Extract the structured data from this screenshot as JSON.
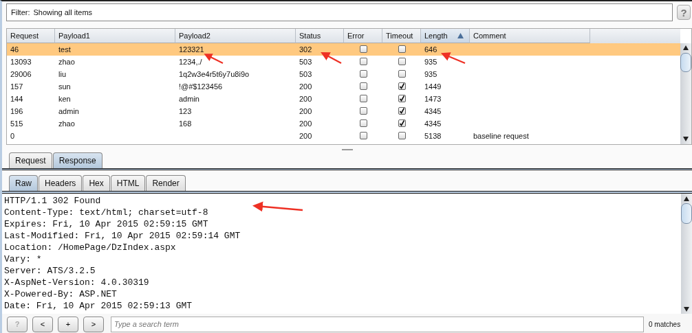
{
  "filter": {
    "label": "Filter:",
    "text": "Showing all items",
    "help": "?"
  },
  "table": {
    "columns": [
      {
        "label": "Request",
        "sorted": false
      },
      {
        "label": "Payload1",
        "sorted": false
      },
      {
        "label": "Payload2",
        "sorted": false
      },
      {
        "label": "Status",
        "sorted": false
      },
      {
        "label": "Error",
        "sorted": false
      },
      {
        "label": "Timeout",
        "sorted": false
      },
      {
        "label": "Length",
        "sorted": true
      },
      {
        "label": "Comment",
        "sorted": false
      }
    ],
    "rows": [
      {
        "request": "46",
        "payload1": "test",
        "payload2": "123321",
        "status": "302",
        "error": false,
        "timeout": false,
        "length": "646",
        "comment": "",
        "selected": true
      },
      {
        "request": "13093",
        "payload1": "zhao",
        "payload2": "1234,./",
        "status": "503",
        "error": false,
        "timeout": false,
        "length": "935",
        "comment": "",
        "selected": false
      },
      {
        "request": "29006",
        "payload1": "liu",
        "payload2": "1q2w3e4r5t6y7u8i9o",
        "status": "503",
        "error": false,
        "timeout": false,
        "length": "935",
        "comment": "",
        "selected": false
      },
      {
        "request": "157",
        "payload1": "sun",
        "payload2": "!@#$123456",
        "status": "200",
        "error": false,
        "timeout": true,
        "length": "1449",
        "comment": "",
        "selected": false
      },
      {
        "request": "144",
        "payload1": "ken",
        "payload2": "admin",
        "status": "200",
        "error": false,
        "timeout": true,
        "length": "1473",
        "comment": "",
        "selected": false
      },
      {
        "request": "196",
        "payload1": "admin",
        "payload2": "123",
        "status": "200",
        "error": false,
        "timeout": true,
        "length": "4345",
        "comment": "",
        "selected": false
      },
      {
        "request": "515",
        "payload1": "zhao",
        "payload2": "168",
        "status": "200",
        "error": false,
        "timeout": true,
        "length": "4345",
        "comment": "",
        "selected": false
      },
      {
        "request": "0",
        "payload1": "",
        "payload2": "",
        "status": "200",
        "error": false,
        "timeout": false,
        "length": "5138",
        "comment": "baseline request",
        "selected": false
      }
    ]
  },
  "tabs": [
    {
      "label": "Request",
      "selected": false
    },
    {
      "label": "Response",
      "selected": true
    }
  ],
  "view_tabs": [
    {
      "label": "Raw",
      "selected": true
    },
    {
      "label": "Headers",
      "selected": false
    },
    {
      "label": "Hex",
      "selected": false
    },
    {
      "label": "HTML",
      "selected": false
    },
    {
      "label": "Render",
      "selected": false
    }
  ],
  "response_lines": [
    "HTTP/1.1 302 Found",
    "Content-Type: text/html; charset=utf-8",
    "Expires: Fri, 10 Apr 2015 02:59:15 GMT",
    "Last-Modified: Fri, 10 Apr 2015 02:59:14 GMT",
    "Location: /HomePage/DzIndex.aspx",
    "Vary: *",
    "Server: ATS/3.2.5",
    "X-AspNet-Version: 4.0.30319",
    "X-Powered-By: ASP.NET",
    "Date: Fri, 10 Apr 2015 02:59:13 GMT"
  ],
  "search_bar": {
    "buttons": [
      "?",
      "<",
      "+",
      ">"
    ],
    "placeholder": "Type a search term",
    "matches": "0 matches"
  }
}
